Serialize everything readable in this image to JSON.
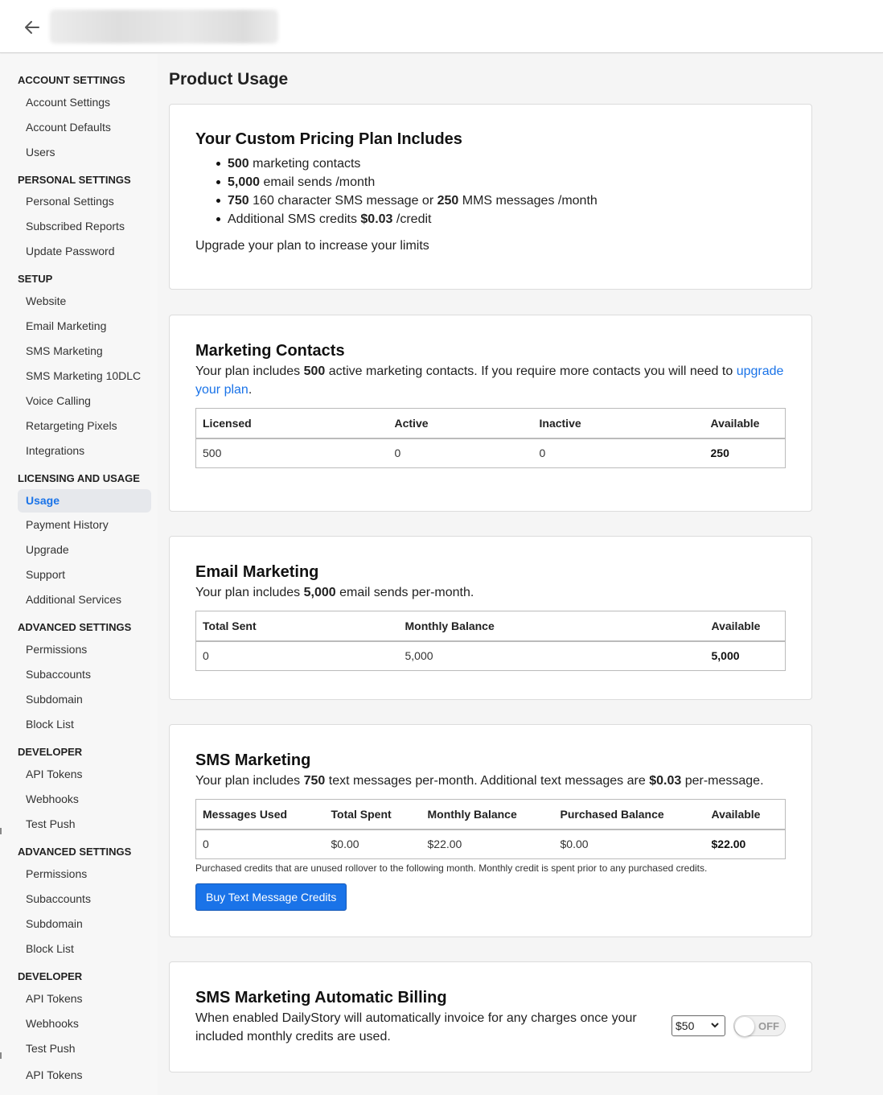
{
  "header": {
    "back_icon": "arrow-left-icon"
  },
  "sidebar": {
    "groups": [
      {
        "title": "ACCOUNT SETTINGS",
        "items": [
          "Account Settings",
          "Account Defaults",
          "Users"
        ]
      },
      {
        "title": "PERSONAL SETTINGS",
        "items": [
          "Personal Settings",
          "Subscribed Reports",
          "Update Password"
        ]
      },
      {
        "title": "SETUP",
        "items": [
          "Website",
          "Email Marketing",
          "SMS Marketing",
          "SMS Marketing 10DLC",
          "Voice Calling",
          "Retargeting Pixels",
          "Integrations"
        ]
      },
      {
        "title": "LICENSING AND USAGE",
        "items": [
          "Usage",
          "Payment History",
          "Upgrade",
          "Support",
          "Additional Services"
        ]
      },
      {
        "title": "ADVANCED SETTINGS",
        "items": [
          "Permissions",
          "Subaccounts",
          "Subdomain",
          "Block List"
        ]
      },
      {
        "title": "DEVELOPER",
        "items": [
          "API Tokens",
          "Webhooks",
          "Test Push"
        ]
      },
      {
        "title": "ADVANCED SETTINGS",
        "items": [
          "Permissions",
          "Subaccounts",
          "Subdomain",
          "Block List"
        ]
      },
      {
        "title": "DEVELOPER",
        "items": [
          "API Tokens",
          "Webhooks",
          "Test Push",
          "API Tokens"
        ]
      }
    ],
    "active_item": "Usage"
  },
  "main": {
    "page_title": "Product Usage",
    "plan": {
      "title": "Your Custom Pricing Plan Includes",
      "line1_num": "500",
      "line1_text": " marketing contacts",
      "line2_num": "5,000",
      "line2_text": " email sends /month",
      "line3_num": "750",
      "line3_mid": " 160 character SMS message or ",
      "line3_num2": "250",
      "line3_text": " MMS messages /month",
      "line4_text": "Additional SMS credits ",
      "line4_num": "$0.03",
      "line4_suffix": " /credit",
      "upgrade_link": "Upgrade your plan to increase your limits"
    },
    "contacts": {
      "title": "Marketing Contacts",
      "desc_pre": "Your plan includes ",
      "desc_num": "500",
      "desc_mid": " active marketing contacts. If you require more contacts you will need to ",
      "desc_link": "upgrade your plan",
      "desc_end": ".",
      "headers": [
        "Licensed",
        "Active",
        "Inactive",
        "Available"
      ],
      "row": [
        "500",
        "0",
        "0",
        "250"
      ]
    },
    "email": {
      "title": "Email Marketing",
      "desc_pre": "Your plan includes ",
      "desc_num": "5,000",
      "desc_end": " email sends per-month.",
      "headers": [
        "Total Sent",
        "Monthly Balance",
        "Available"
      ],
      "row": [
        "0",
        "5,000",
        "5,000"
      ]
    },
    "sms": {
      "title": "SMS Marketing",
      "desc_pre": "Your plan includes ",
      "desc_num": "750",
      "desc_mid": " text messages per-month. Additional text messages are ",
      "desc_num2": "$0.03",
      "desc_end": " per-message.",
      "headers": [
        "Messages Used",
        "Total Spent",
        "Monthly Balance",
        "Purchased Balance",
        "Available"
      ],
      "row": [
        "0",
        "$0.00",
        "$22.00",
        "$0.00",
        "$22.00"
      ],
      "note": "Purchased credits that are unused rollover to the following month. Monthly credit is spent prior to any purchased credits.",
      "buy_button": "Buy Text Message Credits"
    },
    "billing": {
      "title": "SMS Marketing Automatic Billing",
      "desc": "When enabled DailyStory will automatically invoice for any charges once your included monthly credits are used.",
      "select_value": "$50",
      "toggle_label": "OFF"
    }
  },
  "colors": {
    "accent": "#1a73e8",
    "active_bg": "#e6e8ec"
  }
}
